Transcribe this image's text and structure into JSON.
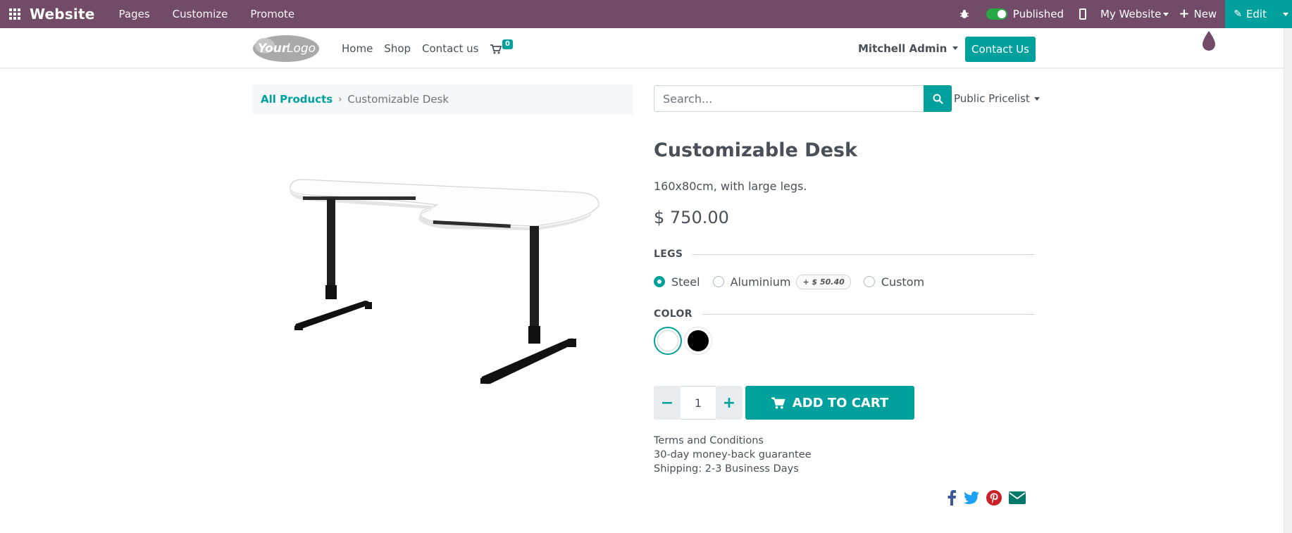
{
  "admin_bar": {
    "brand": "Website",
    "menu": [
      "Pages",
      "Customize",
      "Promote"
    ],
    "published_label": "Published",
    "website_label": "My Website",
    "new_label": "New",
    "edit_label": "Edit",
    "color": "#714b67",
    "accent": "#00a09d"
  },
  "header": {
    "logo_text": "YourLogo",
    "nav": [
      "Home",
      "Shop",
      "Contact us"
    ],
    "cart_count": "0",
    "user": "Mitchell Admin",
    "contact_button": "Contact Us"
  },
  "breadcrumb": {
    "root": "All Products",
    "separator": "›",
    "current": "Customizable Desk"
  },
  "search": {
    "placeholder": "Search...",
    "pricelist": "Public Pricelist"
  },
  "product": {
    "name": "Customizable Desk",
    "description": "160x80cm, with large legs.",
    "price": "$ 750.00",
    "attributes": {
      "legs_label": "LEGS",
      "legs_options": [
        {
          "label": "Steel",
          "selected": true
        },
        {
          "label": "Aluminium",
          "extra": "+ $ 50.40",
          "selected": false
        },
        {
          "label": "Custom",
          "selected": false
        }
      ],
      "color_label": "COLOR",
      "colors": [
        {
          "name": "White",
          "hex": "#ffffff",
          "selected": true
        },
        {
          "name": "Black",
          "hex": "#000000",
          "selected": false
        }
      ]
    },
    "quantity": "1",
    "add_to_cart": "ADD TO CART",
    "info_lines": [
      "Terms and Conditions",
      "30-day money-back guarantee",
      "Shipping: 2-3 Business Days"
    ]
  },
  "share_icons": [
    "facebook-icon",
    "twitter-icon",
    "pinterest-icon",
    "email-icon"
  ]
}
